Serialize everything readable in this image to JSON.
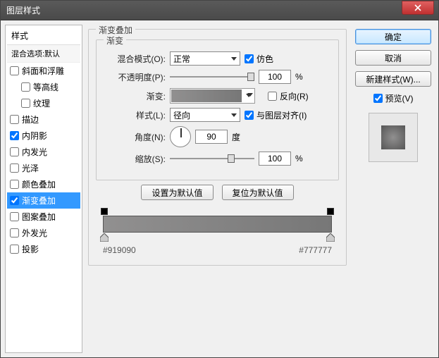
{
  "window": {
    "title": "图层样式"
  },
  "left": {
    "header": "样式",
    "blendOptions": "混合选项:默认",
    "items": [
      {
        "label": "斜面和浮雕",
        "checked": false,
        "indent": false
      },
      {
        "label": "等高线",
        "checked": false,
        "indent": true
      },
      {
        "label": "纹理",
        "checked": false,
        "indent": true
      },
      {
        "label": "描边",
        "checked": false,
        "indent": false
      },
      {
        "label": "内阴影",
        "checked": true,
        "indent": false
      },
      {
        "label": "内发光",
        "checked": false,
        "indent": false
      },
      {
        "label": "光泽",
        "checked": false,
        "indent": false
      },
      {
        "label": "颜色叠加",
        "checked": false,
        "indent": false
      },
      {
        "label": "渐变叠加",
        "checked": true,
        "indent": false,
        "selected": true
      },
      {
        "label": "图案叠加",
        "checked": false,
        "indent": false
      },
      {
        "label": "外发光",
        "checked": false,
        "indent": false
      },
      {
        "label": "投影",
        "checked": false,
        "indent": false
      }
    ]
  },
  "center": {
    "groupTitle": "渐变叠加",
    "innerGroup": "渐变",
    "blendModeLabel": "混合模式(O):",
    "blendModeValue": "正常",
    "ditherLabel": "仿色",
    "ditherChecked": true,
    "opacityLabel": "不透明度(P):",
    "opacityValue": "100",
    "percent": "%",
    "gradientLabel": "渐变:",
    "reverseLabel": "反向(R)",
    "reverseChecked": false,
    "styleLabel": "样式(L):",
    "styleValue": "径向",
    "alignLabel": "与图层对齐(I)",
    "alignChecked": true,
    "angleLabel": "角度(N):",
    "angleValue": "90",
    "degree": "度",
    "scaleLabel": "缩放(S):",
    "scaleValue": "100",
    "btnDefault": "设置为默认值",
    "btnReset": "复位为默认值",
    "gradStops": {
      "left": "#919090",
      "right": "#777777"
    }
  },
  "right": {
    "ok": "确定",
    "cancel": "取消",
    "newStyle": "新建样式(W)...",
    "previewLabel": "预览(V)",
    "previewChecked": true
  }
}
